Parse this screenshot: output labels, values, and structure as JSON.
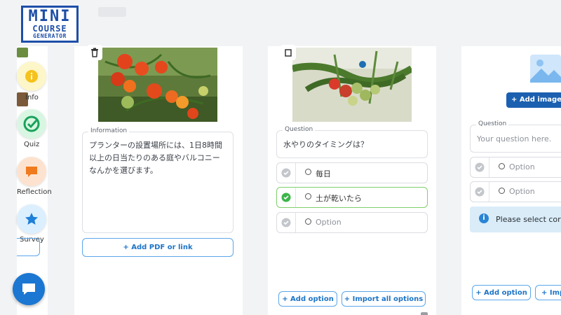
{
  "logo": {
    "line1": "MINI",
    "line2": "COURSE",
    "line3": "GENERATOR"
  },
  "sidebar": {
    "items": [
      {
        "label": "Info",
        "icon": "info-icon",
        "color": "#f6c21b"
      },
      {
        "label": "Quiz",
        "icon": "check-circle-icon",
        "color": "#1aa25a"
      },
      {
        "label": "Reflection",
        "icon": "speech-bubble-icon",
        "color": "#f07a1e"
      },
      {
        "label": "Survey",
        "icon": "star-icon",
        "color": "#1e80d8"
      }
    ],
    "chat_icon": "chat-icon"
  },
  "cards": {
    "info": {
      "field_label": "Information",
      "text": "プランターの設置場所には、1日8時間以上の日当たりのある庭やバルコニーなんかを選びます。",
      "add_pdf_label": "+ Add PDF or link"
    },
    "quiz": {
      "question_label": "Question",
      "question": "水やりのタイミングは？",
      "options": [
        {
          "text": "毎日",
          "correct": false
        },
        {
          "text": "土が乾いたら",
          "correct": true
        },
        {
          "text": "Option",
          "correct": false,
          "placeholder": true
        }
      ],
      "add_option_label": "+ Add option",
      "import_label": "+ Import all options"
    },
    "new_question": {
      "add_image_label": "+ Add image or",
      "question_label": "Question",
      "question_placeholder": "Your question here.",
      "options": [
        {
          "text": "Option"
        },
        {
          "text": "Option"
        }
      ],
      "notice": "Please select corre",
      "add_option_label": "+ Add option",
      "import_label": "+ Imp"
    }
  },
  "colors": {
    "accent": "#1d74c7",
    "correct": "#3cb54a",
    "notice_bg": "#d9ecf8"
  }
}
